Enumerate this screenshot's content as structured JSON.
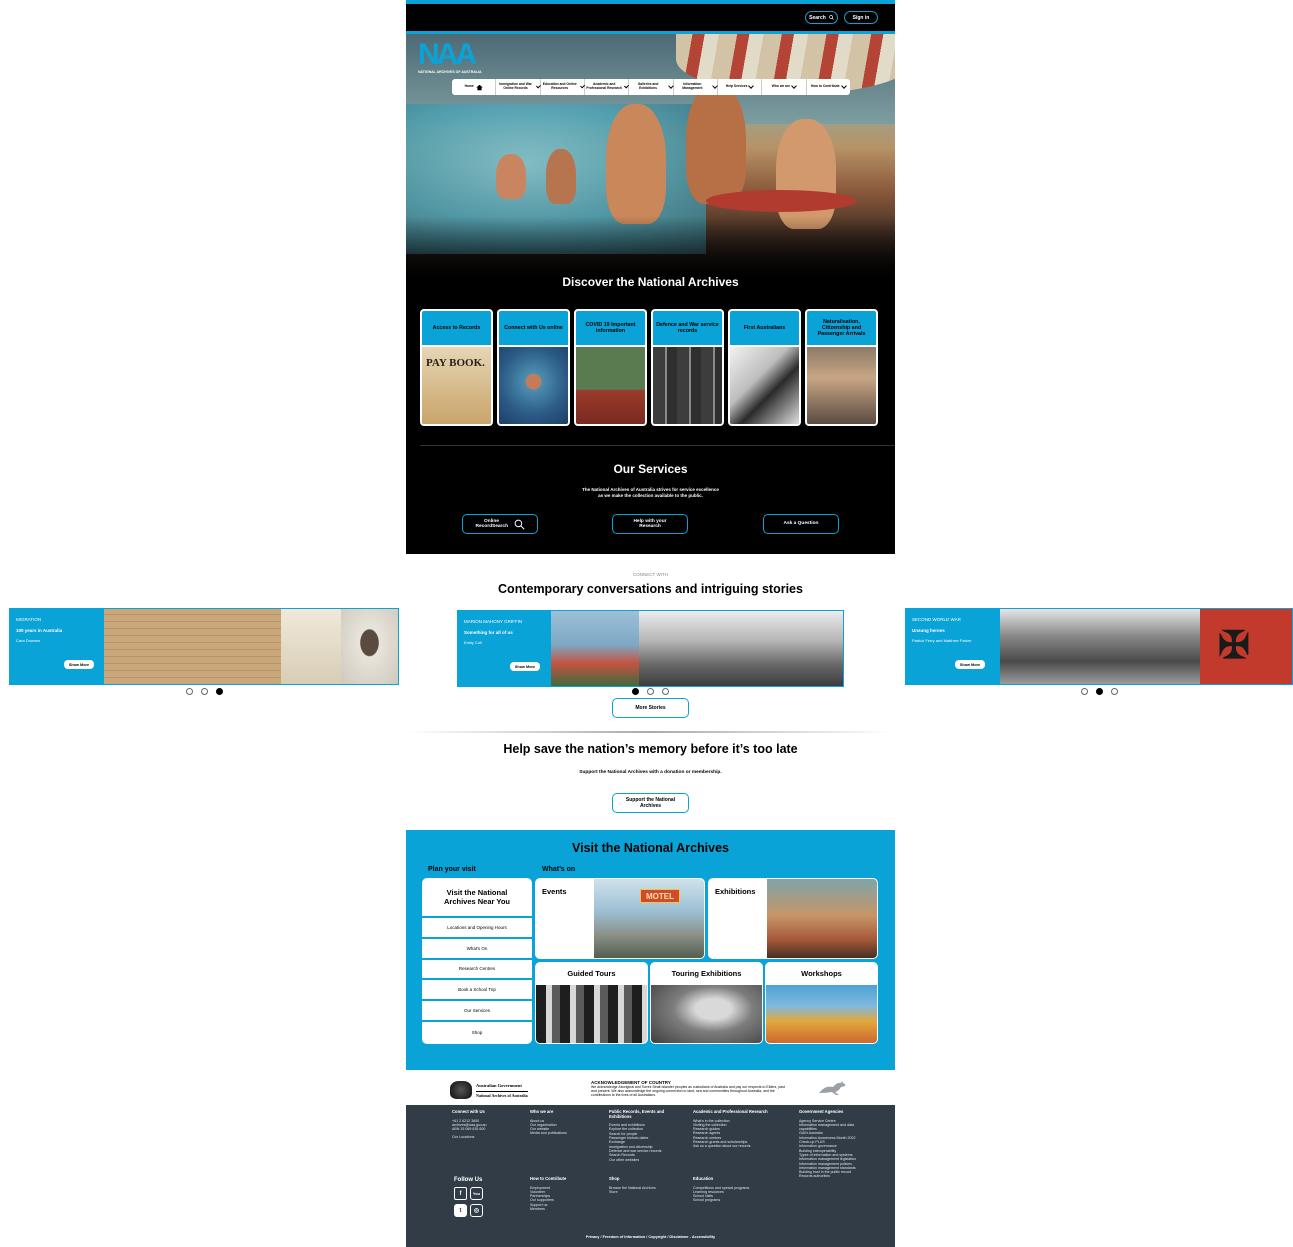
{
  "header": {
    "search_label": "Search",
    "signin_label": "Sign in"
  },
  "logo": {
    "mark": "NAA",
    "sub": "NATIONAL ARCHIVES OF AUSTRALIA"
  },
  "nav": {
    "items": [
      {
        "label": "Home"
      },
      {
        "label": "Immigration and War Online Records"
      },
      {
        "label": "Education and Online Resources"
      },
      {
        "label": "Academic and Professional Research"
      },
      {
        "label": "Galleries and Exhibitions"
      },
      {
        "label": "Information Management"
      },
      {
        "label": "Help Services"
      },
      {
        "label": "Who we are"
      },
      {
        "label": "How to Contribute"
      }
    ]
  },
  "discover": {
    "title": "Discover the National Archives",
    "cards": [
      {
        "label": "Access to Records"
      },
      {
        "label": "Connect with Us online"
      },
      {
        "label": "COVID 19 Important information"
      },
      {
        "label": "Defence and War service records"
      },
      {
        "label": "First Australians"
      },
      {
        "label": "Naturalisation, Citizenship and Passenger Arrivals"
      }
    ]
  },
  "services": {
    "title": "Our Services",
    "sub1": "The National Archives of Australia strives for service excellence",
    "sub2": "as we make the collection available to the public.",
    "buttons": [
      {
        "label": "Online RecordSearch"
      },
      {
        "label": "Help with your Research"
      },
      {
        "label": "Ask a Question"
      }
    ]
  },
  "stories": {
    "kicker": "CONNECT WITH",
    "title": "Contemporary conversations and intriguing stories",
    "more_label": "More Stories",
    "items": [
      {
        "tag": "MIGRATION",
        "headline": "100 years in Australia",
        "author": "Cara Downes",
        "button": "Show More"
      },
      {
        "tag": "MARION MAHONY GRIFFIN",
        "headline": "Something for all of us",
        "author": "Emily Cull",
        "button": "Show More"
      },
      {
        "tag": "SECOND WORLD WAR",
        "headline": "Unsung heroes",
        "author": "Patrick Ferry and Matthew Parker",
        "button": "Show More"
      }
    ]
  },
  "help": {
    "title": "Help save the nation’s memory before it’s too late",
    "sub": "Support the National Archives with a donation or membership.",
    "button": "Support the National Archives"
  },
  "visit": {
    "title": "Visit the National Archives",
    "plan_label": "Plan your visit",
    "whats_on_label": "What’s on",
    "plan_heading": "Visit the National Archives Near You",
    "plan_items": [
      {
        "label": "Locations and Opening Hours"
      },
      {
        "label": "What's On"
      },
      {
        "label": "Research Centres"
      },
      {
        "label": "Book a School Trip"
      },
      {
        "label": "Our Services"
      },
      {
        "label": "Shop"
      }
    ],
    "tiles": [
      {
        "label": "Events"
      },
      {
        "label": "Exhibitions"
      },
      {
        "label": "Guided Tours"
      },
      {
        "label": "Touring Exhibitions"
      },
      {
        "label": "Workshops"
      }
    ],
    "motel_sign": "MOTEL"
  },
  "acknowledgement": {
    "gov_line1": "Australian Government",
    "gov_line2": "National Archives of Australia",
    "title": "ACKNOWLEDGEMENT OF COUNTRY",
    "text": "We acknowledge Aboriginal and Torres Strait Islander peoples as custodians of Australia and pay our respects to Elders, past and present. We also acknowledge the ongoing connection to land, sea and communities throughout Australia, and the contributions to the lives of all Australians."
  },
  "footer": {
    "connect": {
      "heading": "Connect with Us",
      "lines": [
        "+61 2 6212 3600",
        "archives@naa.gov.au",
        "ABN 15 069 635 600",
        "",
        "Our Locations"
      ]
    },
    "who": {
      "heading": "Who we are",
      "lines": [
        "About us",
        "Our organisation",
        "Our website",
        "Media and publications"
      ]
    },
    "public": {
      "heading": "Public Records, Events and Exhibitions",
      "lines": [
        "Events and exhibitions",
        "Explore the collection",
        "Search for people",
        "Passenger historic dates",
        "Exchange",
        "Immigration and citizenship",
        "Defence and war service records",
        "Search Records",
        "Our other websites"
      ]
    },
    "academic": {
      "heading": "Academic and Professional Research",
      "lines": [
        "What's in the collection",
        "Visiting the collection",
        "Research guides",
        "Research agents",
        "Research centres",
        "Research grants and scholarships",
        "Ask us a question about our records"
      ]
    },
    "gov": {
      "heading": "Government Agencies",
      "lines": [
        "Agency Service Centre",
        "Information management and data capabilities",
        "GAIN Australia",
        "Information Awareness Month 2022",
        "Check-up PLUS",
        "Information governance",
        "Building interoperability",
        "Types of information and systems",
        "Information management legislation",
        "Information management policies",
        "Information management standards",
        "Building trust in the public record",
        "Records authorities"
      ]
    },
    "follow_label": "Follow Us",
    "social": [
      {
        "name": "facebook-icon",
        "glyph": "f"
      },
      {
        "name": "youtube-icon",
        "glyph": "You"
      },
      {
        "name": "twitter-icon",
        "glyph": "t"
      },
      {
        "name": "instagram-icon",
        "glyph": "◎"
      }
    ],
    "contribute": {
      "heading": "How to Contribute",
      "lines": [
        "Employment",
        "Volunteer",
        "Partnerships",
        "Our supporters",
        "Support us",
        "Members"
      ]
    },
    "shop": {
      "heading": "Shop",
      "lines": [
        "Browse the National Archives",
        "Store"
      ]
    },
    "education": {
      "heading": "Education",
      "lines": [
        "Competitions and special programs",
        "Learning resources",
        "School visits",
        "School programs"
      ]
    },
    "legal": "Privacy / Freedom of Information / Copyright / Disclaimer - Accessibility"
  },
  "colors": {
    "brand_blue": "#0aa3d7",
    "footer_dark": "#323c47"
  }
}
